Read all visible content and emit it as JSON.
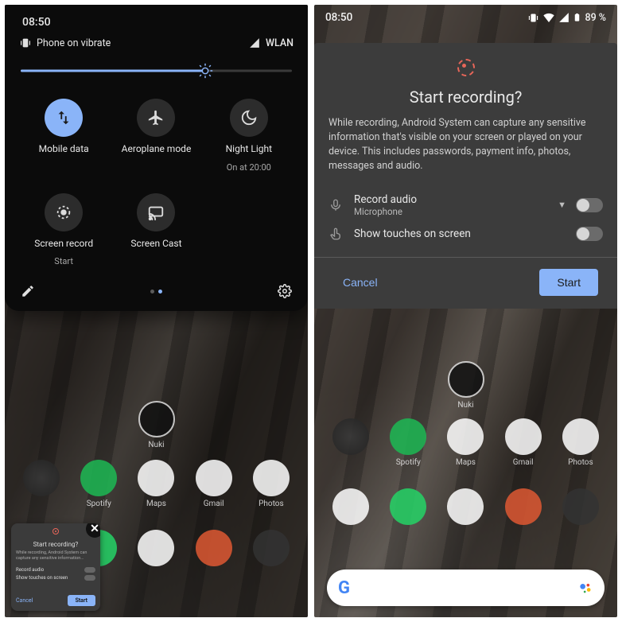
{
  "left": {
    "time": "08:50",
    "vibrate_label": "Phone on vibrate",
    "wifi_label": "WLAN",
    "brightness_percent": 68,
    "tiles": [
      {
        "id": "mobile-data",
        "label": "Mobile data",
        "sub": "",
        "active": true
      },
      {
        "id": "aeroplane",
        "label": "Aeroplane mode",
        "sub": "",
        "active": false
      },
      {
        "id": "night-light",
        "label": "Night Light",
        "sub": "On at 20:00",
        "active": false
      },
      {
        "id": "screen-record",
        "label": "Screen record",
        "sub": "Start",
        "active": false
      },
      {
        "id": "screen-cast",
        "label": "Screen Cast",
        "sub": "",
        "active": false
      }
    ],
    "apps_row1": [
      {
        "id": "nuki",
        "label": "Nuki"
      },
      {
        "id": "folder",
        "label": ""
      },
      {
        "id": "spotify",
        "label": "Spotify"
      },
      {
        "id": "maps",
        "label": "Maps"
      },
      {
        "id": "gmail",
        "label": "Gmail"
      },
      {
        "id": "photos",
        "label": "Photos"
      }
    ]
  },
  "right": {
    "time": "08:50",
    "battery_label": "89 %",
    "dialog": {
      "title": "Start recording?",
      "body": "While recording, Android System can capture any sensitive information that's visible on your screen or played on your device. This includes passwords, payment info, photos, messages and audio.",
      "record_audio_label": "Record audio",
      "record_audio_value": "Microphone",
      "show_touches_label": "Show touches on screen",
      "cancel_label": "Cancel",
      "start_label": "Start"
    },
    "apps_row1": [
      {
        "id": "nuki",
        "label": "Nuki"
      },
      {
        "id": "folder",
        "label": ""
      },
      {
        "id": "spotify",
        "label": "Spotify"
      },
      {
        "id": "maps",
        "label": "Maps"
      },
      {
        "id": "gmail",
        "label": "Gmail"
      },
      {
        "id": "photos",
        "label": "Photos"
      }
    ],
    "apps_row2": [
      {
        "id": "messages",
        "label": ""
      },
      {
        "id": "whatsapp",
        "label": ""
      },
      {
        "id": "slack",
        "label": ""
      },
      {
        "id": "duckduck",
        "label": ""
      },
      {
        "id": "camera",
        "label": ""
      }
    ]
  }
}
